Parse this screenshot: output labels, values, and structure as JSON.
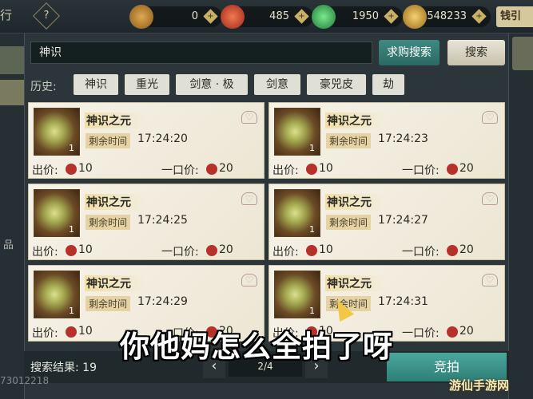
{
  "topbar": {
    "left_text": "行",
    "help_label": "?",
    "currencies": [
      {
        "icon": "bronze-coin-icon",
        "value": "0",
        "plus": "+"
      },
      {
        "icon": "red-orb-icon",
        "value": "485",
        "plus": "+"
      },
      {
        "icon": "jade-ring-icon",
        "value": "1950",
        "plus": "+"
      },
      {
        "icon": "gold-ingot-icon",
        "value": "548233",
        "plus": "+"
      }
    ],
    "shop_label": "钱引"
  },
  "leftside": {
    "label": "品"
  },
  "search": {
    "value": "神识",
    "buy_search_label": "求购搜索",
    "search_label": "搜索"
  },
  "history": {
    "label": "历史:",
    "tags": [
      "神识",
      "重光",
      "剑意 · 极",
      "剑意",
      "豪兕皮",
      "劫"
    ]
  },
  "listings": [
    {
      "name": "神识之元",
      "qty": "1",
      "remain_label": "剩余时间",
      "remain": "17:24:20",
      "bid_label": "出价:",
      "bid": "10",
      "buyout_label": "一口价:",
      "buyout": "20"
    },
    {
      "name": "神识之元",
      "qty": "1",
      "remain_label": "剩余时间",
      "remain": "17:24:23",
      "bid_label": "出价:",
      "bid": "10",
      "buyout_label": "一口价:",
      "buyout": "20"
    },
    {
      "name": "神识之元",
      "qty": "1",
      "remain_label": "剩余时间",
      "remain": "17:24:25",
      "bid_label": "出价:",
      "bid": "10",
      "buyout_label": "一口价:",
      "buyout": "20"
    },
    {
      "name": "神识之元",
      "qty": "1",
      "remain_label": "剩余时间",
      "remain": "17:24:27",
      "bid_label": "出价:",
      "bid": "10",
      "buyout_label": "一口价:",
      "buyout": "20"
    },
    {
      "name": "神识之元",
      "qty": "1",
      "remain_label": "剩余时间",
      "remain": "17:24:29",
      "bid_label": "出价:",
      "bid": "10",
      "buyout_label": "一口价:",
      "buyout": "20"
    },
    {
      "name": "神识之元",
      "qty": "1",
      "remain_label": "剩余时间",
      "remain": "17:24:31",
      "bid_label": "出价:",
      "bid": "10",
      "buyout_label": "一口价:",
      "buyout": "20"
    }
  ],
  "footer": {
    "result_label": "搜索结果: 19",
    "page_prev": "‹",
    "page_value": "2/4",
    "page_next": "›",
    "bid_button": "竞拍",
    "uid": "73012218"
  },
  "overlay": {
    "subtitle": "你他妈怎么全拍了呀",
    "watermark": "游仙手游网"
  }
}
